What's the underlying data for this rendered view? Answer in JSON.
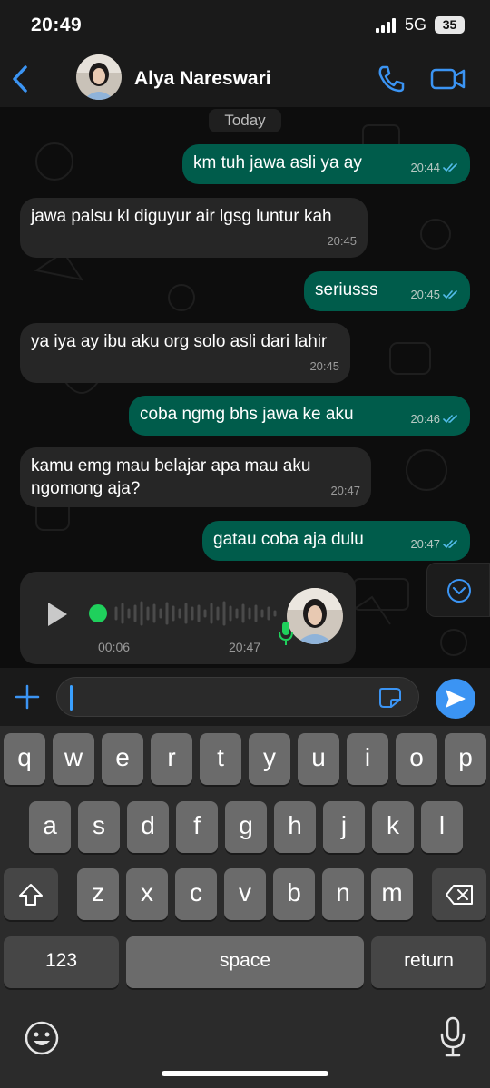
{
  "status": {
    "time": "20:49",
    "network": "5G",
    "battery": "35"
  },
  "header": {
    "contact_name": "Alya Nareswari"
  },
  "chat": {
    "date_label": "Today",
    "messages": [
      {
        "dir": "out",
        "text": "km tuh jawa asli ya ay",
        "time": "20:44"
      },
      {
        "dir": "in",
        "text": "jawa palsu kl diguyur air lgsg luntur kah",
        "time": "20:45"
      },
      {
        "dir": "out",
        "text": "seriusss",
        "time": "20:45"
      },
      {
        "dir": "in",
        "text": "ya iya ay ibu aku org solo asli dari lahir",
        "time": "20:45"
      },
      {
        "dir": "out",
        "text": "coba ngmg bhs jawa ke aku",
        "time": "20:46"
      },
      {
        "dir": "in",
        "text": "kamu emg mau belajar apa mau aku ngomong aja?",
        "time": "20:47"
      },
      {
        "dir": "out",
        "text": "gatau coba aja dulu",
        "time": "20:47"
      }
    ],
    "voice_note": {
      "duration": "00:06",
      "time": "20:47"
    }
  },
  "input": {
    "placeholder": ""
  },
  "keyboard": {
    "row1": [
      "q",
      "w",
      "e",
      "r",
      "t",
      "y",
      "u",
      "i",
      "o",
      "p"
    ],
    "row2": [
      "a",
      "s",
      "d",
      "f",
      "g",
      "h",
      "j",
      "k",
      "l"
    ],
    "row3": [
      "z",
      "x",
      "c",
      "v",
      "b",
      "n",
      "m"
    ],
    "numbers_label": "123",
    "space_label": "space",
    "return_label": "return"
  },
  "colors": {
    "outgoing_bubble": "#005c4b",
    "incoming_bubble": "#262626",
    "accent": "#3b94f3",
    "voice_dot": "#1fd05c"
  }
}
